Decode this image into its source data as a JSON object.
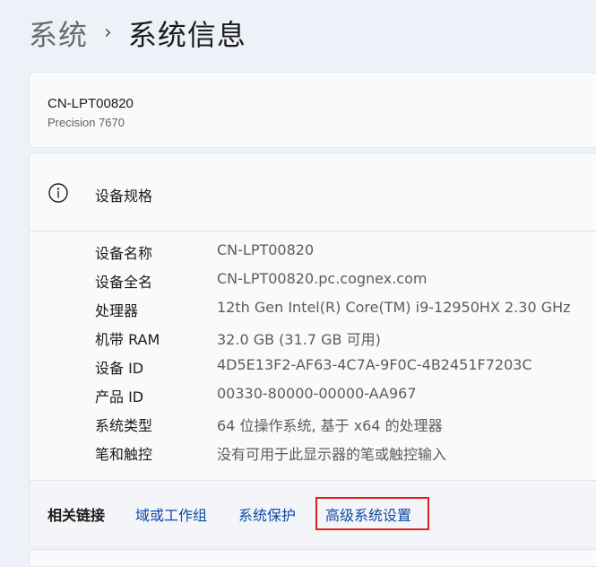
{
  "breadcrumb": {
    "parent": "系统",
    "separator": "›",
    "current": "系统信息"
  },
  "device": {
    "name": "CN-LPT00820",
    "model": "Precision 7670"
  },
  "specs": {
    "title": "设备规格",
    "icon": "info-icon",
    "rows": [
      {
        "label": "设备名称",
        "value": "CN-LPT00820"
      },
      {
        "label": "设备全名",
        "value": "CN-LPT00820.pc.cognex.com"
      },
      {
        "label": "处理器",
        "value": "12th Gen Intel(R) Core(TM) i9-12950HX   2.30 GHz"
      },
      {
        "label": "机带 RAM",
        "value": "32.0 GB (31.7 GB 可用)"
      },
      {
        "label": "设备 ID",
        "value": "4D5E13F2-AF63-4C7A-9F0C-4B2451F7203C"
      },
      {
        "label": "产品 ID",
        "value": "00330-80000-00000-AA967"
      },
      {
        "label": "系统类型",
        "value": "64 位操作系统, 基于 x64 的处理器"
      },
      {
        "label": "笔和触控",
        "value": "没有可用于此显示器的笔或触控输入"
      }
    ]
  },
  "related": {
    "label": "相关链接",
    "links": [
      "域或工作组",
      "系统保护",
      "高级系统设置"
    ],
    "highlighted_link": "高级系统设置"
  },
  "colors": {
    "link": "#0c4aa6",
    "highlight": "#e0201c",
    "background": "#eef2f8",
    "card": "#f9fafc"
  }
}
